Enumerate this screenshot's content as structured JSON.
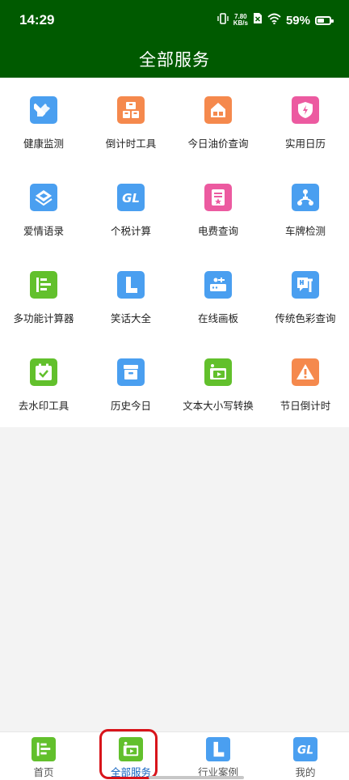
{
  "status_bar": {
    "time": "14:29",
    "speed_value": "7.80",
    "speed_unit": "KB/s",
    "battery_percent": "59%",
    "battery_level": 0.59,
    "icons": [
      "vibrate-icon",
      "no-sim-icon",
      "wifi-icon",
      "battery-icon"
    ]
  },
  "header": {
    "title": "全部服务"
  },
  "services": [
    {
      "label": "健康监测",
      "icon": "pencil-ruler-icon",
      "color": "#4a9ff0"
    },
    {
      "label": "倒计时工具",
      "icon": "boxes-icon",
      "color": "#f5894d"
    },
    {
      "label": "今日油价查询",
      "icon": "house-icon",
      "color": "#f5894d"
    },
    {
      "label": "实用日历",
      "icon": "shield-bolt-icon",
      "color": "#ec5aa0"
    },
    {
      "label": "爱情语录",
      "icon": "layers-icon",
      "color": "#4a9ff0"
    },
    {
      "label": "个税计算",
      "icon": "gl-icon",
      "color": "#4a9ff0"
    },
    {
      "label": "电费查询",
      "icon": "certificate-icon",
      "color": "#ec5aa0"
    },
    {
      "label": "车牌检测",
      "icon": "network-icon",
      "color": "#4a9ff0"
    },
    {
      "label": "多功能计算器",
      "icon": "list-arrow-icon",
      "color": "#62c02c"
    },
    {
      "label": "笑话大全",
      "icon": "l-letter-icon",
      "color": "#4a9ff0"
    },
    {
      "label": "在线画板",
      "icon": "router-icon",
      "color": "#4a9ff0"
    },
    {
      "label": "传统色彩查询",
      "icon": "wrench-chat-icon",
      "color": "#4a9ff0"
    },
    {
      "label": "去水印工具",
      "icon": "calendar-check-icon",
      "color": "#62c02c"
    },
    {
      "label": "历史今日",
      "icon": "archive-icon",
      "color": "#4a9ff0"
    },
    {
      "label": "文本大小写转换",
      "icon": "video-player-icon",
      "color": "#62c02c"
    },
    {
      "label": "节日倒计时",
      "icon": "warning-icon",
      "color": "#f5894d"
    }
  ],
  "bottom_nav": [
    {
      "label": "首页",
      "icon": "list-arrow-icon",
      "color": "#62c02c"
    },
    {
      "label": "全部服务",
      "icon": "video-player-icon",
      "color": "#62c02c",
      "active": true
    },
    {
      "label": "行业案例",
      "icon": "l-letter-icon",
      "color": "#4a9ff0"
    },
    {
      "label": "我的",
      "icon": "gl-icon",
      "color": "#4a9ff0"
    }
  ],
  "colors": {
    "header_bg": "#005a00",
    "active_nav_text": "#1565c0",
    "highlight_ring": "#d8141b"
  }
}
